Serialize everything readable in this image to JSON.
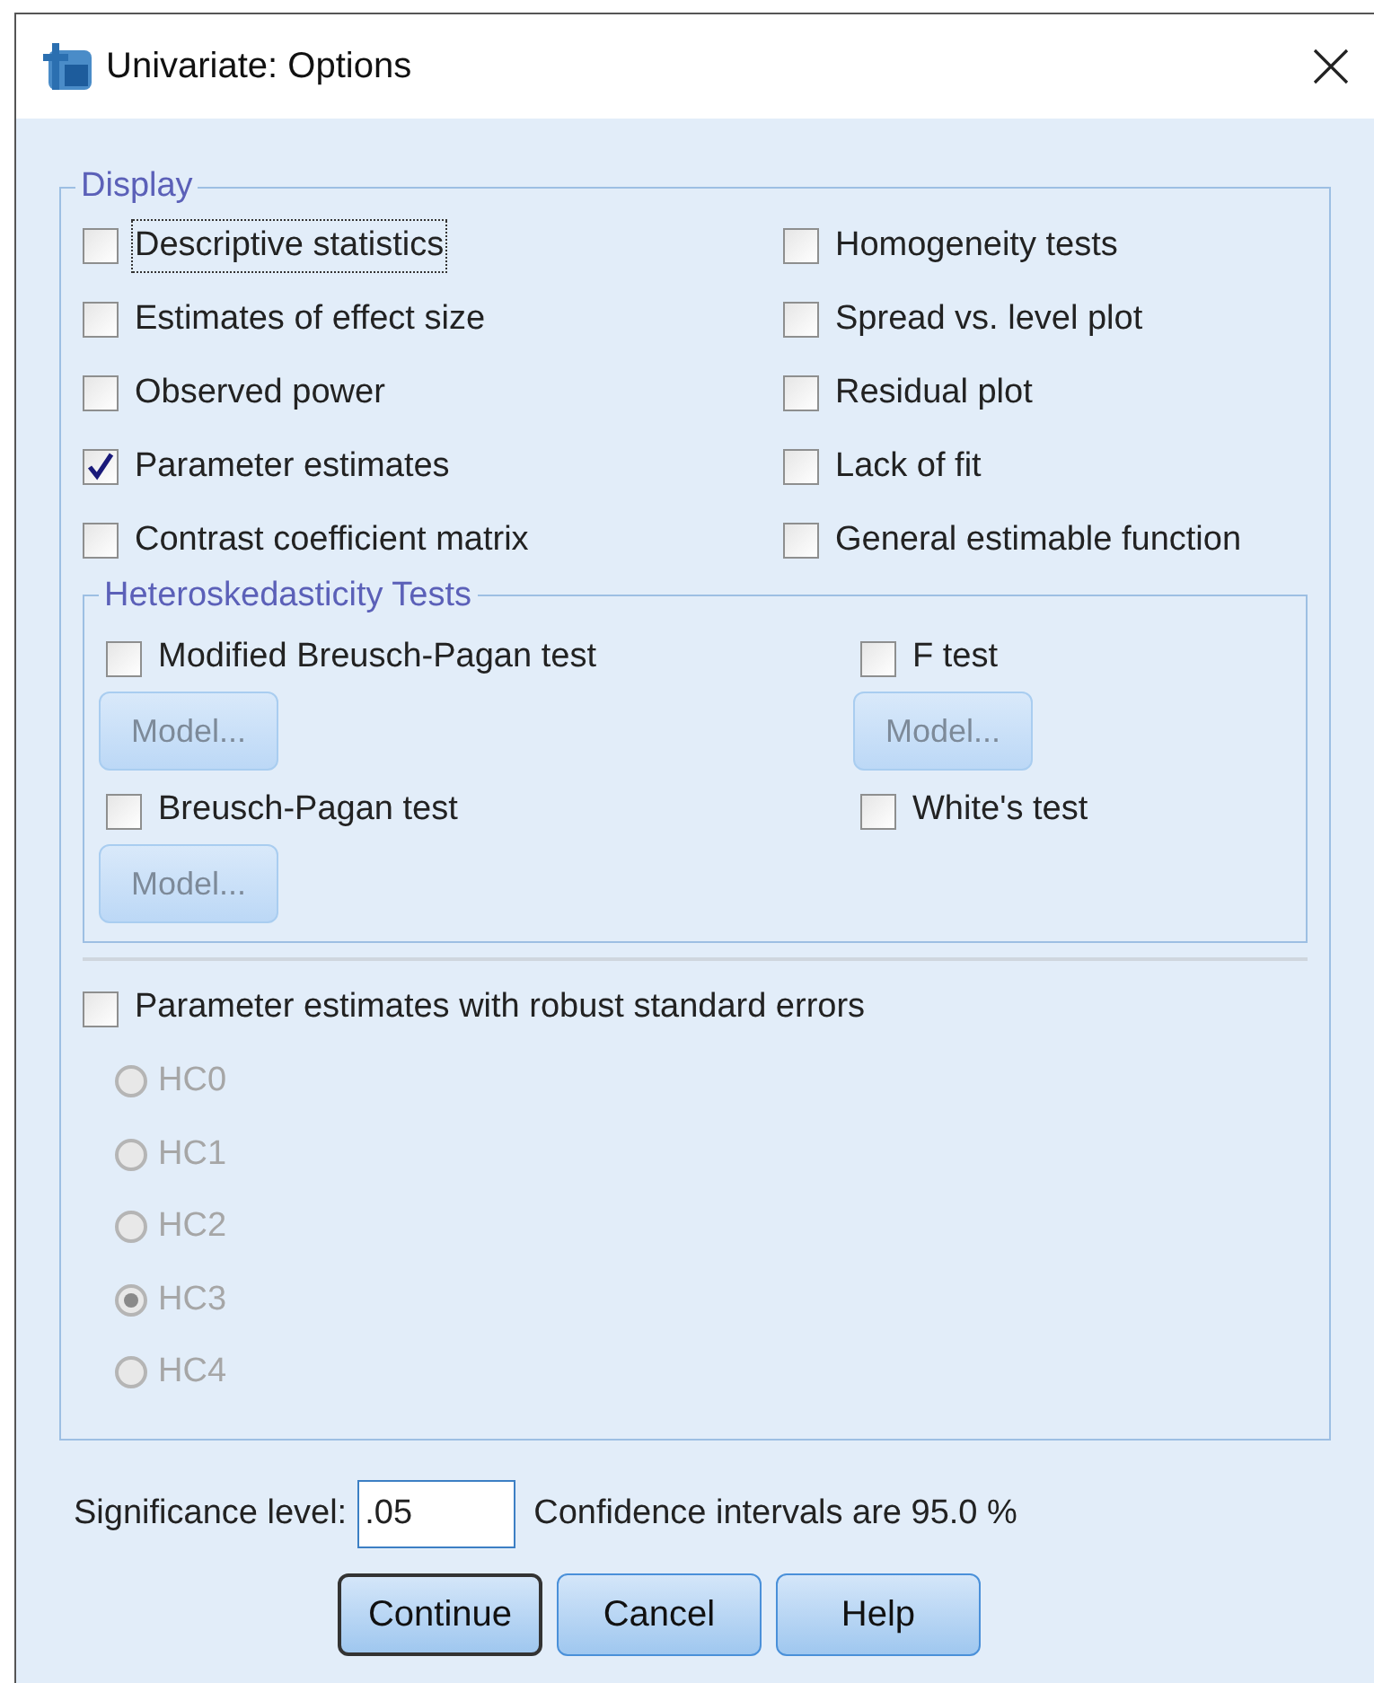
{
  "window": {
    "title": "Univariate: Options"
  },
  "display": {
    "title": "Display",
    "left": [
      {
        "label": "Descriptive statistics",
        "checked": false,
        "focused": true
      },
      {
        "label": "Estimates of effect size",
        "checked": false,
        "focused": false
      },
      {
        "label": "Observed power",
        "checked": false,
        "focused": false
      },
      {
        "label": "Parameter estimates",
        "checked": true,
        "focused": false
      },
      {
        "label": "Contrast coefficient matrix",
        "checked": false,
        "focused": false
      }
    ],
    "right": [
      {
        "label": "Homogeneity tests",
        "checked": false,
        "focused": false
      },
      {
        "label": "Spread vs. level plot",
        "checked": false,
        "focused": false
      },
      {
        "label": "Residual plot",
        "checked": false,
        "focused": false
      },
      {
        "label": "Lack of fit",
        "checked": false,
        "focused": false
      },
      {
        "label": "General estimable function",
        "checked": false,
        "focused": false
      }
    ]
  },
  "heteroskedasticity": {
    "title": "Heteroskedasticity Tests",
    "tests": [
      {
        "label": "Modified Breusch-Pagan test",
        "checked": false,
        "model_button": {
          "label": "Model...",
          "disabled": true
        }
      },
      {
        "label": "F test",
        "checked": false,
        "model_button": {
          "label": "Model...",
          "disabled": true
        }
      },
      {
        "label": "Breusch-Pagan test",
        "checked": false,
        "model_button": {
          "label": "Model...",
          "disabled": true
        }
      },
      {
        "label": "White's test",
        "checked": false
      }
    ]
  },
  "robust": {
    "label": "Parameter estimates with robust standard errors",
    "checked": false,
    "options": [
      {
        "label": "HC0",
        "selected": false,
        "disabled": true
      },
      {
        "label": "HC1",
        "selected": false,
        "disabled": true
      },
      {
        "label": "HC2",
        "selected": false,
        "disabled": true
      },
      {
        "label": "HC3",
        "selected": true,
        "disabled": true
      },
      {
        "label": "HC4",
        "selected": false,
        "disabled": true
      }
    ]
  },
  "significance": {
    "label": "Significance level:",
    "value": ".05",
    "note": "Confidence intervals are 95.0 %"
  },
  "buttons": [
    {
      "label": "Continue",
      "default": true
    },
    {
      "label": "Cancel",
      "default": false
    },
    {
      "label": "Help",
      "default": false
    }
  ]
}
